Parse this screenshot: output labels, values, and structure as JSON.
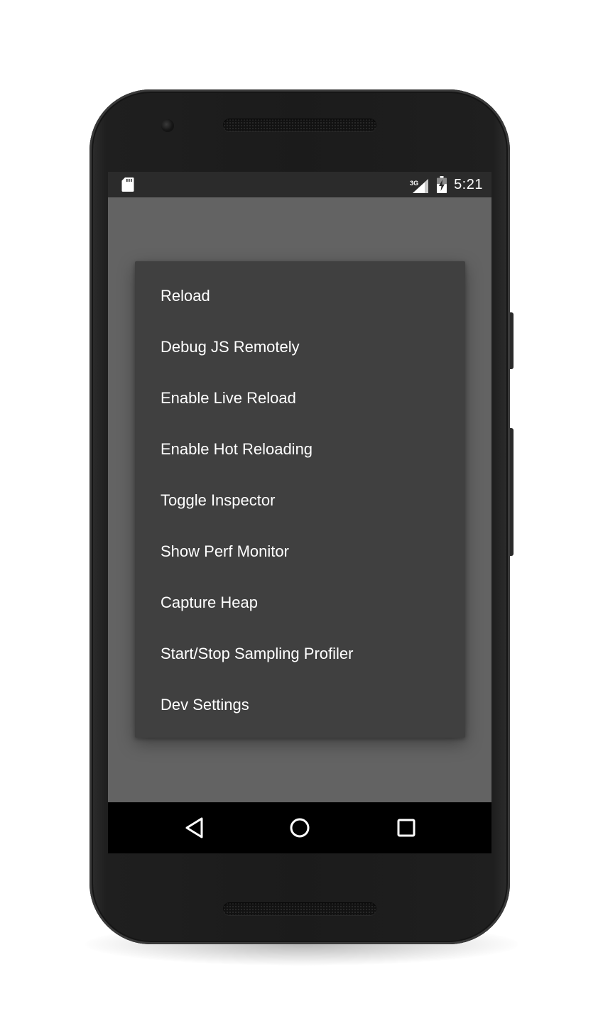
{
  "status_bar": {
    "network_type": "3G",
    "time": "5:21",
    "left_icon": "sd-card-icon",
    "signal_icon": "cellular-signal-icon",
    "battery_icon": "battery-charging-icon"
  },
  "dev_menu": {
    "items": [
      {
        "label": "Reload"
      },
      {
        "label": "Debug JS Remotely"
      },
      {
        "label": "Enable Live Reload"
      },
      {
        "label": "Enable Hot Reloading"
      },
      {
        "label": "Toggle Inspector"
      },
      {
        "label": "Show Perf Monitor"
      },
      {
        "label": "Capture Heap"
      },
      {
        "label": "Start/Stop Sampling Profiler"
      },
      {
        "label": "Dev Settings"
      }
    ]
  },
  "nav_bar": {
    "back_icon": "back-triangle-icon",
    "home_icon": "home-circle-icon",
    "recents_icon": "recents-square-icon"
  },
  "colors": {
    "scrim": "#636363",
    "dialog_bg": "#404040",
    "status_bar_bg": "#2b2b2b",
    "nav_bar_bg": "#000000",
    "text": "#ffffff"
  }
}
